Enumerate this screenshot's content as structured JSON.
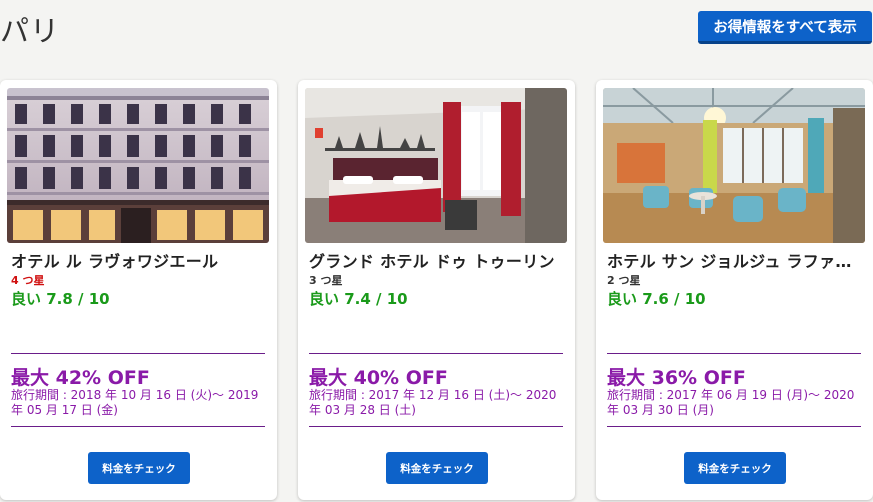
{
  "header": {
    "title": "パリ",
    "show_all_label": "お得情報をすべて表示"
  },
  "colors": {
    "brand_blue": "#0d62c9",
    "rating_green": "#1a9a1a",
    "deal_purple": "#8a1aa8",
    "star_red": "#d01010"
  },
  "cards": [
    {
      "name": "オテル ル ラヴォワジエール",
      "stars": "4 つ星",
      "rating": "良い 7.8 / 10",
      "discount": "最大 42% OFF",
      "period": "旅行期間 : 2018 年 10 月 16 日 (火)〜 2019 年 05 月 17 日 (金)",
      "button": "料金をチェック"
    },
    {
      "name": "グランド ホテル ドゥ トゥーリン",
      "stars": "3 つ星",
      "rating": "良い 7.4 / 10",
      "discount": "最大 40% OFF",
      "period": "旅行期間 : 2017 年 12 月 16 日 (土)〜 2020 年 03 月 28 日 (土)",
      "button": "料金をチェック"
    },
    {
      "name": "ホテル サン ジョルジュ ラファイエット",
      "stars": "2 つ星",
      "rating": "良い 7.6 / 10",
      "discount": "最大 36% OFF",
      "period": "旅行期間 : 2017 年 06 月 19 日 (月)〜 2020 年 03 月 30 日 (月)",
      "button": "料金をチェック"
    }
  ]
}
